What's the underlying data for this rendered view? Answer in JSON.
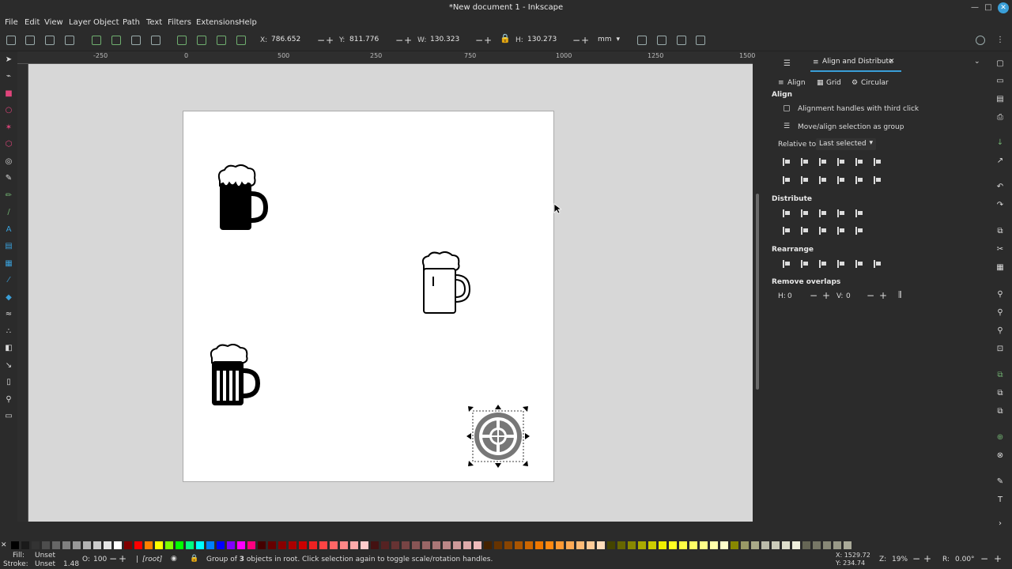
{
  "window": {
    "title": "*New document 1 - Inkscape"
  },
  "menu": [
    "File",
    "Edit",
    "View",
    "Layer",
    "Object",
    "Path",
    "Text",
    "Filters",
    "Extensions",
    "Help"
  ],
  "toolctrl": {
    "x_label": "X:",
    "x_value": "786.652",
    "y_label": "Y:",
    "y_value": "811.776",
    "w_label": "W:",
    "w_value": "130.323",
    "h_label": "H:",
    "h_value": "130.273",
    "unit": "mm"
  },
  "ruler": {
    "labels": [
      "-250",
      "0",
      "250",
      "500",
      "750",
      "1000",
      "1250",
      "1500"
    ]
  },
  "dock": {
    "active_tab": "Align and Distribute",
    "subtabs": [
      "Align",
      "Grid",
      "Circular"
    ],
    "align_heading": "Align",
    "opt_handles": "Alignment handles with third click",
    "opt_group": "Move/align selection as group",
    "relative_label": "Relative to:",
    "relative_value": "Last selected",
    "distribute_heading": "Distribute",
    "rearrange_heading": "Rearrange",
    "remove_overlaps_heading": "Remove overlaps",
    "h_label": "H:",
    "h_value": "0",
    "v_label": "V:",
    "v_value": "0"
  },
  "status": {
    "fill_label": "Fill:",
    "fill_value": "Unset",
    "stroke_label": "Stroke:",
    "stroke_value": "Unset",
    "stroke_width": "1.48",
    "opacity_label": "O:",
    "opacity_value": "100",
    "layer": "[root]",
    "message_pre": "Group of ",
    "message_count": "3",
    "message_post": " objects in root. Click selection again to toggle scale/rotation handles.",
    "cursor_x": "X: 1529.72",
    "cursor_y": "Y: 234.74",
    "zoom_label": "Z:",
    "zoom_value": "19%",
    "rotation_label": "R:",
    "rotation_value": "0.00°"
  }
}
